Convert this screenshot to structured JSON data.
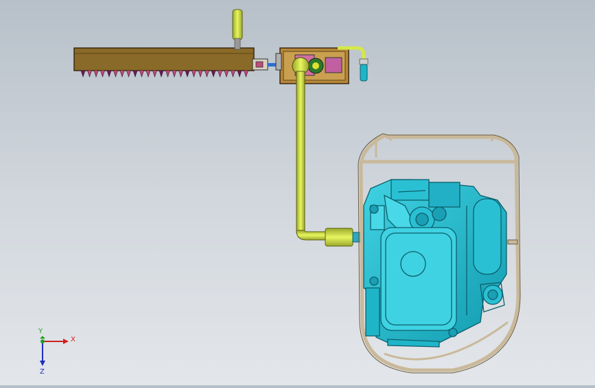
{
  "viewport": {
    "background_top": "#b7c0c9",
    "background_bottom": "#e3e6ea"
  },
  "model": {
    "colors": {
      "engine": "#1fb5c9",
      "engine_dark": "#0c5f6b",
      "frame": "#c9b99a",
      "shaft": "#d4e84a",
      "bar": "#8a6a28",
      "teeth": "#c04a7a",
      "gearbox": "#b8873a"
    }
  },
  "triad": {
    "x_label": "X",
    "y_label": "Y",
    "z_label": "Z",
    "x_color": "#d02020",
    "y_color": "#20a020",
    "z_color": "#2030c0"
  }
}
